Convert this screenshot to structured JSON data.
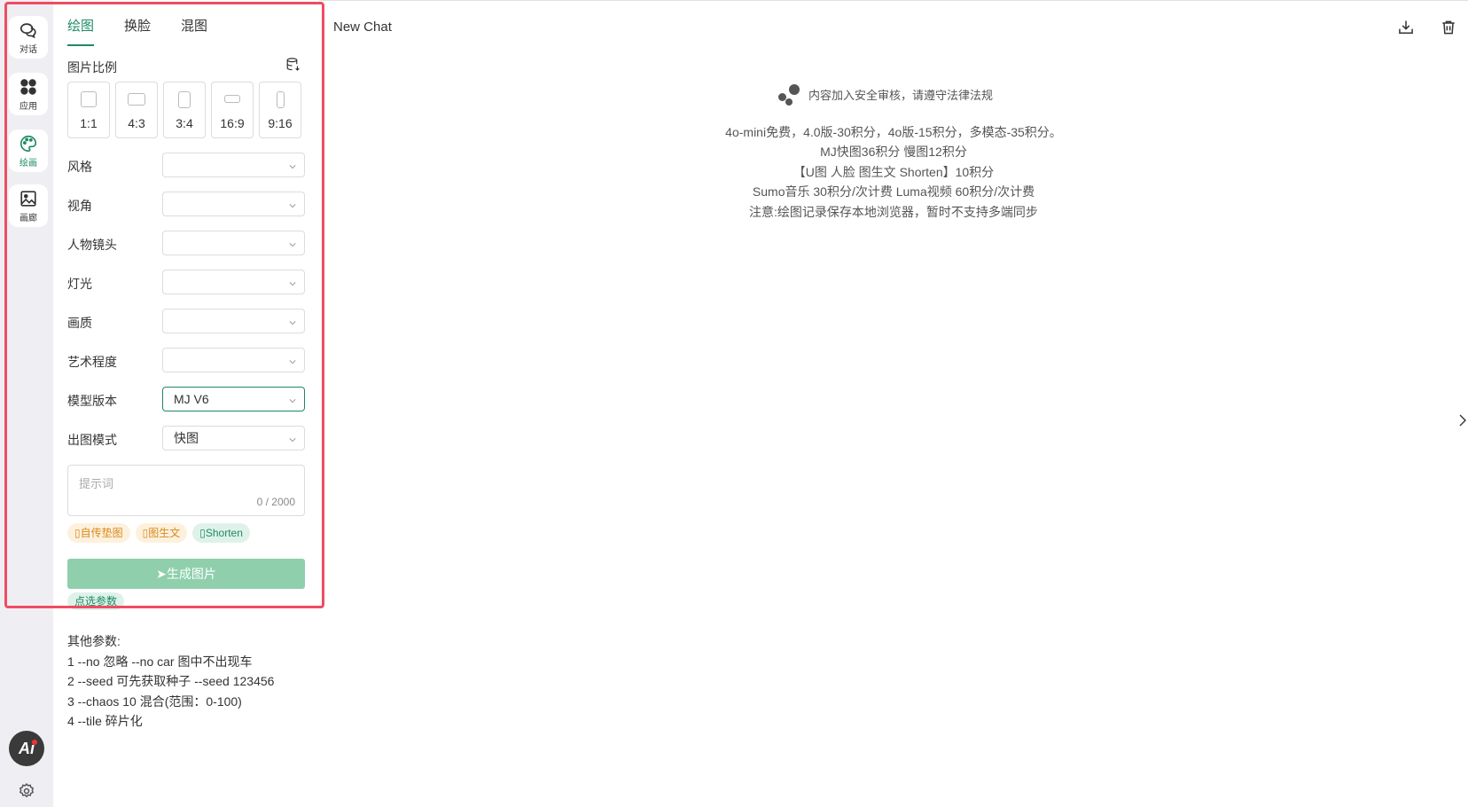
{
  "rail": {
    "items": [
      {
        "label": "对话",
        "icon": "chat-icon"
      },
      {
        "label": "应用",
        "icon": "apps-icon"
      },
      {
        "label": "绘画",
        "icon": "palette-icon"
      },
      {
        "label": "画廊",
        "icon": "gallery-icon"
      }
    ],
    "logo_text": "Ai"
  },
  "panel": {
    "tabs": [
      "绘图",
      "换脸",
      "混图"
    ],
    "ratio_title": "图片比例",
    "ratios": [
      "1:1",
      "4:3",
      "3:4",
      "16:9",
      "9:16"
    ],
    "fields": [
      {
        "label": "风格",
        "value": ""
      },
      {
        "label": "视角",
        "value": ""
      },
      {
        "label": "人物镜头",
        "value": ""
      },
      {
        "label": "灯光",
        "value": ""
      },
      {
        "label": "画质",
        "value": ""
      },
      {
        "label": "艺术程度",
        "value": ""
      },
      {
        "label": "模型版本",
        "value": "MJ V6"
      },
      {
        "label": "出图模式",
        "value": "快图"
      }
    ],
    "prompt_placeholder": "提示词",
    "prompt_count": "0 / 2000",
    "chips": [
      "自传垫图",
      "图生文",
      "Shorten"
    ],
    "generate_label": "生成图片",
    "params_chip": "点选参数",
    "other_params": [
      "其他参数:",
      "1 --no 忽略 --no car 图中不出现车",
      "2 --seed 可先获取种子 --seed 123456",
      "3 --chaos 10 混合(范围：0-100)",
      "4 --tile 碎片化"
    ]
  },
  "main": {
    "title": "New Chat",
    "notice_top": "内容加入安全审核，请遵守法律法规",
    "notice_lines": [
      "4o-mini免费，4.0版-30积分，4o版-15积分，多模态-35积分。",
      "MJ快图36积分 慢图12积分",
      "【U图 人脸 图生文 Shorten】10积分",
      "Sumo音乐 30积分/次计费 Luma视频 60积分/次计费",
      "注意:绘图记录保存本地浏览器，暂时不支持多端同步"
    ]
  },
  "colors": {
    "accent": "#1e8a63",
    "highlight": "#ee4d62",
    "button": "#8fcfac"
  }
}
